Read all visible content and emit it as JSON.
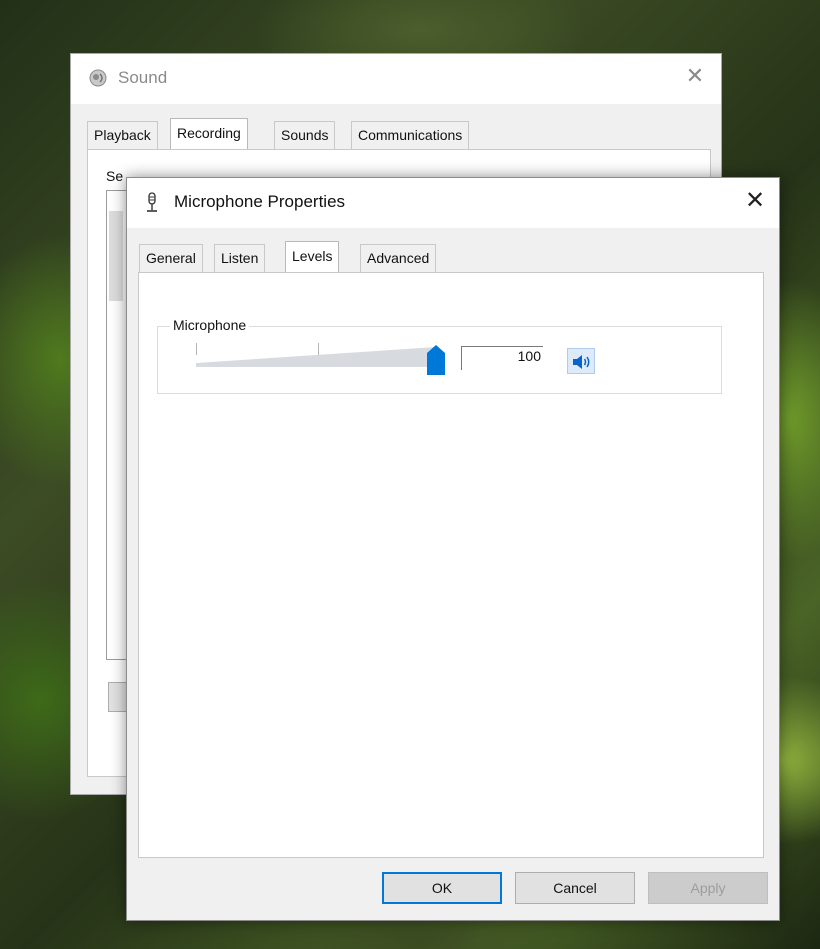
{
  "sound_window": {
    "title": "Sound",
    "close_glyph": "✕",
    "tabs": [
      {
        "label": "Playback"
      },
      {
        "label": "Recording"
      },
      {
        "label": "Sounds"
      },
      {
        "label": "Communications"
      }
    ],
    "active_tab": "Recording",
    "partial_text": "Se"
  },
  "mic_window": {
    "title": "Microphone Properties",
    "close_glyph": "✕",
    "tabs": [
      {
        "label": "General"
      },
      {
        "label": "Listen"
      },
      {
        "label": "Levels"
      },
      {
        "label": "Advanced"
      }
    ],
    "active_tab": "Levels",
    "levels": {
      "group_label": "Microphone",
      "slider_value": 100,
      "value_text": "100",
      "mute_icon": "speaker-icon"
    },
    "buttons": {
      "ok": "OK",
      "cancel": "Cancel",
      "apply": "Apply"
    }
  },
  "colors": {
    "accent": "#0078d7",
    "window_bg": "#f0f0f0",
    "panel_bg": "#ffffff",
    "disabled_text": "#9d9d9d"
  }
}
